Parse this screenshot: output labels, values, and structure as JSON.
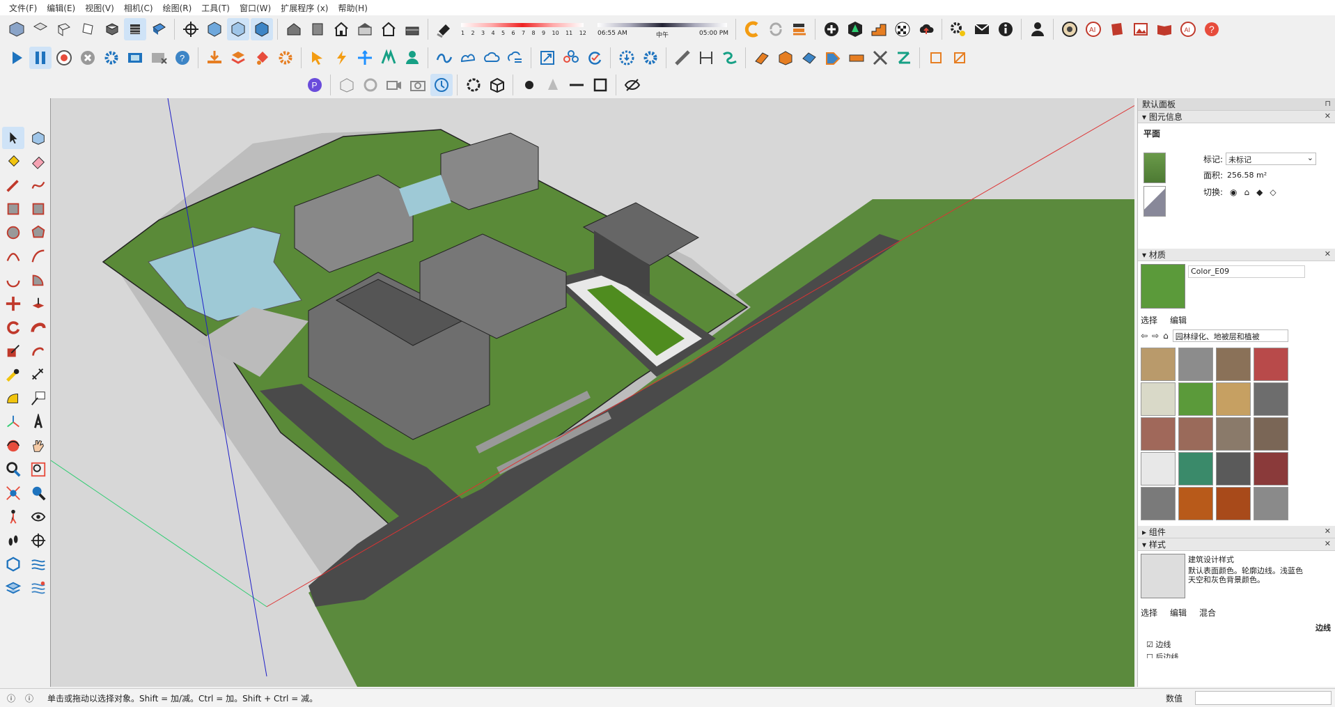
{
  "menu": [
    "文件(F)",
    "编辑(E)",
    "视图(V)",
    "相机(C)",
    "绘图(R)",
    "工具(T)",
    "窗口(W)",
    "扩展程序 (x)",
    "帮助(H)"
  ],
  "shadow": {
    "months": [
      "1",
      "2",
      "3",
      "4",
      "5",
      "6",
      "7",
      "8",
      "9",
      "10",
      "11",
      "12"
    ],
    "time_start": "06:55 AM",
    "time_mid": "中午",
    "time_end": "05:00 PM"
  },
  "panel": {
    "title": "默认面板",
    "entity": {
      "header": "图元信息",
      "type": "平面",
      "tag_label": "标记:",
      "tag_value": "未标记",
      "area_label": "面积:",
      "area_value": "256.58 m²",
      "toggle_label": "切换:"
    },
    "materials": {
      "header": "材质",
      "name": "Color_E09",
      "tab_select": "选择",
      "tab_edit": "编辑",
      "library": "园林绿化、地被层和植被"
    },
    "components": {
      "header": "组件"
    },
    "styles": {
      "header": "样式",
      "name": "建筑设计样式",
      "desc": "默认表面颜色。轮廓边线。浅蓝色天空和灰色背景颜色。",
      "tab_select": "选择",
      "tab_edit": "编辑",
      "tab_mix": "混合",
      "edges_title": "边线",
      "chk_edges": "边线",
      "chk_back": "后边线"
    }
  },
  "status": {
    "text": "单击或拖动以选择对象。Shift = 加/减。Ctrl = 加。Shift + Ctrl = 减。",
    "value_label": "数值"
  },
  "colors": {
    "grass": "#5a8a3c",
    "road": "#4a4a4a",
    "roof": "#6e6e6e",
    "water": "#9ec9d6",
    "accent": "#1e73be"
  },
  "swatches": [
    "#b99a6b",
    "#8c8c8c",
    "#8a7158",
    "#b84a4a",
    "#d9d9c8",
    "#5b9a3a",
    "#c6a062",
    "#6d6d6d",
    "#a0685a",
    "#9a6a5a",
    "#8a7a6a",
    "#7a6656",
    "#e8e8e8",
    "#3a8a6a",
    "#5a5a5a",
    "#8a3a3a",
    "#7a7a7a",
    "#b85a1a",
    "#a84a1a",
    "#8a8a8a"
  ]
}
